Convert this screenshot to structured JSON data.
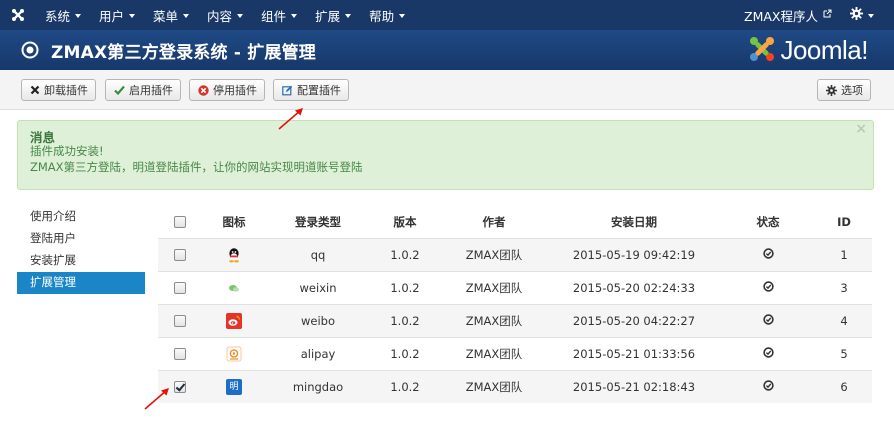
{
  "topnav": {
    "menu": [
      {
        "label": "系统",
        "name": "menu-system"
      },
      {
        "label": "用户",
        "name": "menu-users"
      },
      {
        "label": "菜单",
        "name": "menu-menus"
      },
      {
        "label": "内容",
        "name": "menu-content"
      },
      {
        "label": "组件",
        "name": "menu-components"
      },
      {
        "label": "扩展",
        "name": "menu-extensions"
      },
      {
        "label": "帮助",
        "name": "menu-help"
      }
    ],
    "user_label": "ZMAX程序人"
  },
  "header": {
    "title": "ZMAX第三方登录系统 - 扩展管理",
    "brand": "Joomla!"
  },
  "toolbar": {
    "uninstall_label": "卸载插件",
    "enable_label": "启用插件",
    "disable_label": "停用插件",
    "configure_label": "配置插件",
    "options_label": "选项"
  },
  "message": {
    "heading": "消息",
    "line1": "插件成功安装!",
    "line2": "ZMAX第三方登陆，明道登陆插件，让你的网站实现明道账号登陆",
    "close": "×"
  },
  "sidebar": {
    "items": [
      {
        "label": "使用介绍",
        "active": false
      },
      {
        "label": "登陆用户",
        "active": false
      },
      {
        "label": "安装扩展",
        "active": false
      },
      {
        "label": "扩展管理",
        "active": true
      }
    ]
  },
  "table": {
    "headers": {
      "icon": "图标",
      "login_type": "登录类型",
      "version": "版本",
      "author": "作者",
      "install_date": "安装日期",
      "status": "状态",
      "id": "ID"
    },
    "rows": [
      {
        "icon": "qq-icon",
        "type": "qq",
        "version": "1.0.2",
        "author": "ZMAX团队",
        "date": "2015-05-19 09:42:19",
        "id": "1",
        "checked": false
      },
      {
        "icon": "wechat-icon",
        "type": "weixin",
        "version": "1.0.2",
        "author": "ZMAX团队",
        "date": "2015-05-20 02:24:33",
        "id": "3",
        "checked": false
      },
      {
        "icon": "weibo-icon",
        "type": "weibo",
        "version": "1.0.2",
        "author": "ZMAX团队",
        "date": "2015-05-20 04:22:27",
        "id": "4",
        "checked": false
      },
      {
        "icon": "alipay-icon",
        "type": "alipay",
        "version": "1.0.2",
        "author": "ZMAX团队",
        "date": "2015-05-21 01:33:56",
        "id": "5",
        "checked": false
      },
      {
        "icon": "mingdao-icon",
        "type": "mingdao",
        "version": "1.0.2",
        "author": "ZMAX团队",
        "date": "2015-05-21 02:18:43",
        "id": "6",
        "checked": true
      }
    ],
    "mingdao_glyph": "明"
  },
  "colors": {
    "nav_bg": "#1a3867",
    "header_bg": "#1f4a86",
    "sidebar_active": "#1a86c8",
    "alert_bg": "#dff0d8",
    "alert_text": "#468847",
    "annotation_arrow": "#e3120b"
  }
}
